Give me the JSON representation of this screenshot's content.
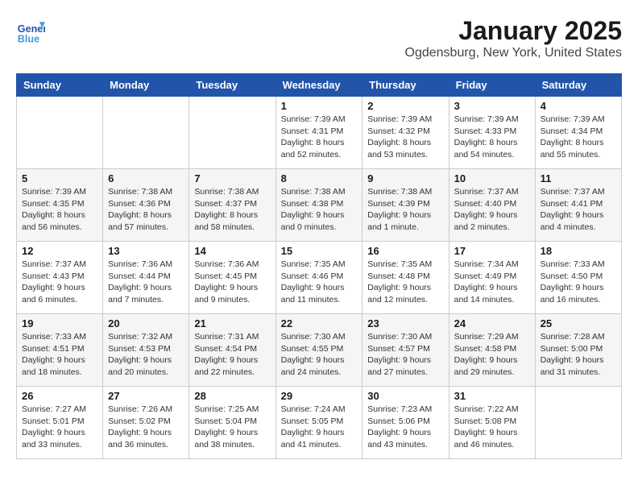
{
  "header": {
    "logo_line1": "General",
    "logo_line2": "Blue",
    "title": "January 2025",
    "subtitle": "Ogdensburg, New York, United States"
  },
  "days_of_week": [
    "Sunday",
    "Monday",
    "Tuesday",
    "Wednesday",
    "Thursday",
    "Friday",
    "Saturday"
  ],
  "weeks": [
    [
      {
        "day": "",
        "info": ""
      },
      {
        "day": "",
        "info": ""
      },
      {
        "day": "",
        "info": ""
      },
      {
        "day": "1",
        "info": "Sunrise: 7:39 AM\nSunset: 4:31 PM\nDaylight: 8 hours and 52 minutes."
      },
      {
        "day": "2",
        "info": "Sunrise: 7:39 AM\nSunset: 4:32 PM\nDaylight: 8 hours and 53 minutes."
      },
      {
        "day": "3",
        "info": "Sunrise: 7:39 AM\nSunset: 4:33 PM\nDaylight: 8 hours and 54 minutes."
      },
      {
        "day": "4",
        "info": "Sunrise: 7:39 AM\nSunset: 4:34 PM\nDaylight: 8 hours and 55 minutes."
      }
    ],
    [
      {
        "day": "5",
        "info": "Sunrise: 7:39 AM\nSunset: 4:35 PM\nDaylight: 8 hours and 56 minutes."
      },
      {
        "day": "6",
        "info": "Sunrise: 7:38 AM\nSunset: 4:36 PM\nDaylight: 8 hours and 57 minutes."
      },
      {
        "day": "7",
        "info": "Sunrise: 7:38 AM\nSunset: 4:37 PM\nDaylight: 8 hours and 58 minutes."
      },
      {
        "day": "8",
        "info": "Sunrise: 7:38 AM\nSunset: 4:38 PM\nDaylight: 9 hours and 0 minutes."
      },
      {
        "day": "9",
        "info": "Sunrise: 7:38 AM\nSunset: 4:39 PM\nDaylight: 9 hours and 1 minute."
      },
      {
        "day": "10",
        "info": "Sunrise: 7:37 AM\nSunset: 4:40 PM\nDaylight: 9 hours and 2 minutes."
      },
      {
        "day": "11",
        "info": "Sunrise: 7:37 AM\nSunset: 4:41 PM\nDaylight: 9 hours and 4 minutes."
      }
    ],
    [
      {
        "day": "12",
        "info": "Sunrise: 7:37 AM\nSunset: 4:43 PM\nDaylight: 9 hours and 6 minutes."
      },
      {
        "day": "13",
        "info": "Sunrise: 7:36 AM\nSunset: 4:44 PM\nDaylight: 9 hours and 7 minutes."
      },
      {
        "day": "14",
        "info": "Sunrise: 7:36 AM\nSunset: 4:45 PM\nDaylight: 9 hours and 9 minutes."
      },
      {
        "day": "15",
        "info": "Sunrise: 7:35 AM\nSunset: 4:46 PM\nDaylight: 9 hours and 11 minutes."
      },
      {
        "day": "16",
        "info": "Sunrise: 7:35 AM\nSunset: 4:48 PM\nDaylight: 9 hours and 12 minutes."
      },
      {
        "day": "17",
        "info": "Sunrise: 7:34 AM\nSunset: 4:49 PM\nDaylight: 9 hours and 14 minutes."
      },
      {
        "day": "18",
        "info": "Sunrise: 7:33 AM\nSunset: 4:50 PM\nDaylight: 9 hours and 16 minutes."
      }
    ],
    [
      {
        "day": "19",
        "info": "Sunrise: 7:33 AM\nSunset: 4:51 PM\nDaylight: 9 hours and 18 minutes."
      },
      {
        "day": "20",
        "info": "Sunrise: 7:32 AM\nSunset: 4:53 PM\nDaylight: 9 hours and 20 minutes."
      },
      {
        "day": "21",
        "info": "Sunrise: 7:31 AM\nSunset: 4:54 PM\nDaylight: 9 hours and 22 minutes."
      },
      {
        "day": "22",
        "info": "Sunrise: 7:30 AM\nSunset: 4:55 PM\nDaylight: 9 hours and 24 minutes."
      },
      {
        "day": "23",
        "info": "Sunrise: 7:30 AM\nSunset: 4:57 PM\nDaylight: 9 hours and 27 minutes."
      },
      {
        "day": "24",
        "info": "Sunrise: 7:29 AM\nSunset: 4:58 PM\nDaylight: 9 hours and 29 minutes."
      },
      {
        "day": "25",
        "info": "Sunrise: 7:28 AM\nSunset: 5:00 PM\nDaylight: 9 hours and 31 minutes."
      }
    ],
    [
      {
        "day": "26",
        "info": "Sunrise: 7:27 AM\nSunset: 5:01 PM\nDaylight: 9 hours and 33 minutes."
      },
      {
        "day": "27",
        "info": "Sunrise: 7:26 AM\nSunset: 5:02 PM\nDaylight: 9 hours and 36 minutes."
      },
      {
        "day": "28",
        "info": "Sunrise: 7:25 AM\nSunset: 5:04 PM\nDaylight: 9 hours and 38 minutes."
      },
      {
        "day": "29",
        "info": "Sunrise: 7:24 AM\nSunset: 5:05 PM\nDaylight: 9 hours and 41 minutes."
      },
      {
        "day": "30",
        "info": "Sunrise: 7:23 AM\nSunset: 5:06 PM\nDaylight: 9 hours and 43 minutes."
      },
      {
        "day": "31",
        "info": "Sunrise: 7:22 AM\nSunset: 5:08 PM\nDaylight: 9 hours and 46 minutes."
      },
      {
        "day": "",
        "info": ""
      }
    ]
  ]
}
